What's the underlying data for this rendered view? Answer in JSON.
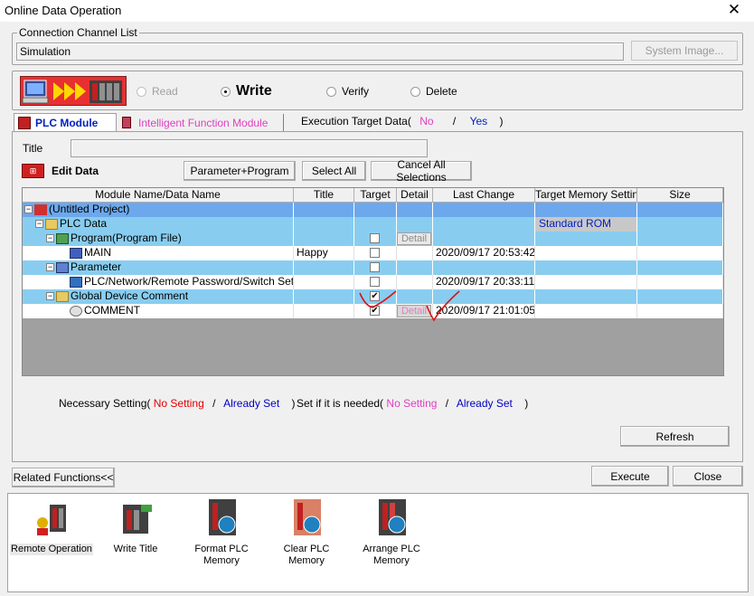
{
  "window": {
    "title": "Online Data Operation",
    "close_glyph": "✕"
  },
  "connection": {
    "legend": "Connection Channel List",
    "value": "Simulation",
    "system_image_label": "System Image..."
  },
  "operation": {
    "read_label": "Read",
    "write_label": "Write",
    "verify_label": "Verify",
    "delete_label": "Delete",
    "selected": "Write"
  },
  "tabs": {
    "plc_module": "PLC Module",
    "intelligent": "Intelligent Function Module",
    "execution_target_label": "Execution Target Data(",
    "no_label": "No",
    "slash": "/",
    "yes_label": "Yes",
    "close_paren": ")"
  },
  "title_field": {
    "label": "Title",
    "value": ""
  },
  "edit_data": {
    "label": "Edit Data",
    "param_program_button": "Parameter+Program",
    "select_all_button": "Select All",
    "cancel_all_button": "Cancel All Selections"
  },
  "grid": {
    "headers": [
      "Module Name/Data Name",
      "Title",
      "Target",
      "Detail",
      "Last Change",
      "Target Memory Setting",
      "Size"
    ],
    "rows": [
      {
        "name": "(Untitled Project)",
        "title": "",
        "target": null,
        "detail": "",
        "last_change": "",
        "memory": "",
        "size": ""
      },
      {
        "name": "PLC Data",
        "title": "",
        "target": null,
        "detail": "",
        "last_change": "",
        "memory": "Standard ROM",
        "size": ""
      },
      {
        "name": "Program(Program File)",
        "title": "",
        "target": false,
        "detail": "Detail",
        "last_change": "",
        "memory": "",
        "size": ""
      },
      {
        "name": "MAIN",
        "title": "Happy",
        "target": false,
        "detail": "",
        "last_change": "2020/09/17 20:53:42",
        "memory": "",
        "size": ""
      },
      {
        "name": "Parameter",
        "title": "",
        "target": false,
        "detail": "",
        "last_change": "",
        "memory": "",
        "size": ""
      },
      {
        "name": "PLC/Network/Remote Password/Switch Setti...",
        "title": "",
        "target": false,
        "detail": "",
        "last_change": "2020/09/17 20:33:11",
        "memory": "",
        "size": ""
      },
      {
        "name": "Global Device Comment",
        "title": "",
        "target": true,
        "detail": "",
        "last_change": "",
        "memory": "",
        "size": ""
      },
      {
        "name": "COMMENT",
        "title": "",
        "target": true,
        "detail": "Detail",
        "last_change": "2020/09/17 21:01:05",
        "memory": "",
        "size": ""
      }
    ]
  },
  "legend": {
    "necessary_label": "Necessary Setting(",
    "no_setting": "No Setting",
    "slash": "/",
    "already_set": "Already Set",
    "close_paren": ")",
    "if_needed_label": "Set if it is needed(",
    "no_setting_2": "No Setting",
    "already_set_2": "Already Set"
  },
  "buttons": {
    "refresh": "Refresh",
    "related": "Related Functions<<",
    "execute": "Execute",
    "close": "Close"
  },
  "related_functions": [
    {
      "line1": "Remote Operation",
      "line2": ""
    },
    {
      "line1": "Write Title",
      "line2": ""
    },
    {
      "line1": "Format PLC",
      "line2": "Memory"
    },
    {
      "line1": "Clear PLC Memory",
      "line2": ""
    },
    {
      "line1": "Arrange PLC",
      "line2": "Memory"
    }
  ],
  "colors": {
    "selected_row": "#6da8ec",
    "blue_row": "#88cdf0",
    "no_setting_red": "#e00000",
    "already_set_blue": "#0000c0",
    "magenta": "#e040c0",
    "annotation_red": "#e01010"
  },
  "checkmark": "✔"
}
